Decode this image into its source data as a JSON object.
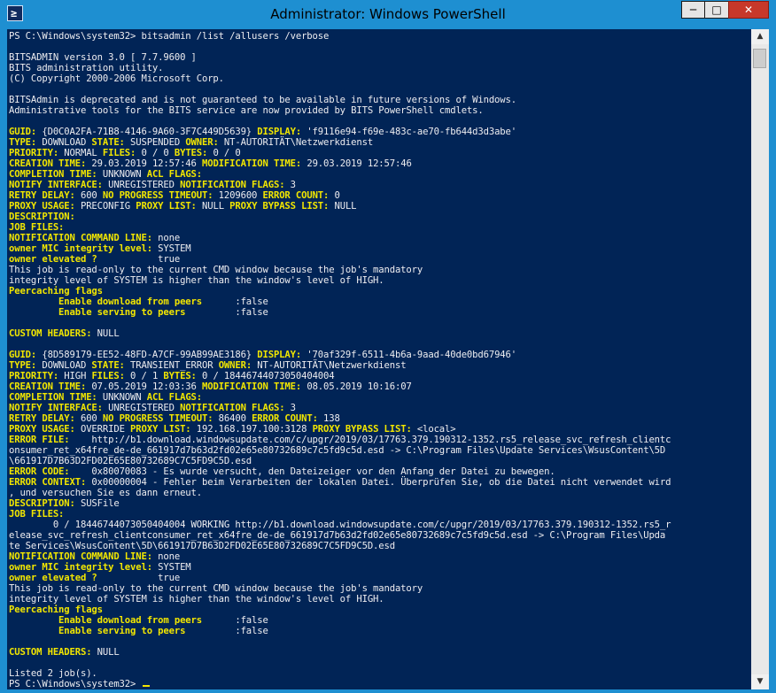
{
  "window": {
    "title": "Administrator: Windows PowerShell",
    "icon_glyph": "≥",
    "controls": {
      "minimize": "─",
      "maximize": "□",
      "close": "✕"
    },
    "colors": {
      "frame": "#1e8fd1",
      "console_bg": "#012456",
      "console_text": "#eeedf0",
      "highlight": "#f2e600"
    }
  },
  "scrollbar": {
    "up": "▲",
    "down": "▼"
  },
  "terminal": {
    "lines": [
      [
        [
          "w",
          "PS C:\\Windows\\system32> bitsadmin /list /allusers /verbose"
        ]
      ],
      [],
      [
        [
          "w",
          "BITSADMIN version 3.0 [ 7.7.9600 ]"
        ]
      ],
      [
        [
          "w",
          "BITS administration utility."
        ]
      ],
      [
        [
          "w",
          "(C) Copyright 2000-2006 Microsoft Corp."
        ]
      ],
      [],
      [
        [
          "w",
          "BITSAdmin is deprecated and is not guaranteed to be available in future versions of Windows."
        ]
      ],
      [
        [
          "w",
          "Administrative tools for the BITS service are now provided by BITS PowerShell cmdlets."
        ]
      ],
      [],
      [
        [
          "y",
          "GUID:"
        ],
        [
          "w",
          " {D0C0A2FA-71B8-4146-9A60-3F7C449D5639} "
        ],
        [
          "y",
          "DISPLAY:"
        ],
        [
          "w",
          " 'f9116e94-f69e-483c-ae70-fb644d3d3abe'"
        ]
      ],
      [
        [
          "y",
          "TYPE:"
        ],
        [
          "w",
          " DOWNLOAD "
        ],
        [
          "y",
          "STATE:"
        ],
        [
          "w",
          " SUSPENDED "
        ],
        [
          "y",
          "OWNER:"
        ],
        [
          "w",
          " NT-AUTORITÄT\\Netzwerkdienst"
        ]
      ],
      [
        [
          "y",
          "PRIORITY:"
        ],
        [
          "w",
          " NORMAL "
        ],
        [
          "y",
          "FILES:"
        ],
        [
          "w",
          " 0 / 0 "
        ],
        [
          "y",
          "BYTES:"
        ],
        [
          "w",
          " 0 / 0"
        ]
      ],
      [
        [
          "y",
          "CREATION TIME:"
        ],
        [
          "w",
          " 29.03.2019 12:57:46 "
        ],
        [
          "y",
          "MODIFICATION TIME:"
        ],
        [
          "w",
          " 29.03.2019 12:57:46"
        ]
      ],
      [
        [
          "y",
          "COMPLETION TIME:"
        ],
        [
          "w",
          " UNKNOWN "
        ],
        [
          "y",
          "ACL FLAGS:"
        ]
      ],
      [
        [
          "y",
          "NOTIFY INTERFACE:"
        ],
        [
          "w",
          " UNREGISTERED "
        ],
        [
          "y",
          "NOTIFICATION FLAGS:"
        ],
        [
          "w",
          " 3"
        ]
      ],
      [
        [
          "y",
          "RETRY DELAY:"
        ],
        [
          "w",
          " 600 "
        ],
        [
          "y",
          "NO PROGRESS TIMEOUT:"
        ],
        [
          "w",
          " 1209600 "
        ],
        [
          "y",
          "ERROR COUNT:"
        ],
        [
          "w",
          " 0"
        ]
      ],
      [
        [
          "y",
          "PROXY USAGE:"
        ],
        [
          "w",
          " PRECONFIG "
        ],
        [
          "y",
          "PROXY LIST:"
        ],
        [
          "w",
          " NULL "
        ],
        [
          "y",
          "PROXY BYPASS LIST:"
        ],
        [
          "w",
          " NULL"
        ]
      ],
      [
        [
          "y",
          "DESCRIPTION:"
        ]
      ],
      [
        [
          "y",
          "JOB FILES:"
        ]
      ],
      [
        [
          "y",
          "NOTIFICATION COMMAND LINE:"
        ],
        [
          "w",
          " none"
        ]
      ],
      [
        [
          "y",
          "owner MIC integrity level:"
        ],
        [
          "w",
          " SYSTEM"
        ]
      ],
      [
        [
          "y",
          "owner elevated ?"
        ],
        [
          "w",
          "           true"
        ]
      ],
      [
        [
          "w",
          "This job is read-only to the current CMD window because the job's mandatory"
        ]
      ],
      [
        [
          "w",
          "integrity level of SYSTEM is higher than the window's level of HIGH."
        ]
      ],
      [
        [
          "y",
          "Peercaching flags"
        ]
      ],
      [
        [
          "y",
          "         Enable download from peers"
        ],
        [
          "w",
          "      :false"
        ]
      ],
      [
        [
          "y",
          "         Enable serving to peers"
        ],
        [
          "w",
          "         :false"
        ]
      ],
      [],
      [
        [
          "y",
          "CUSTOM HEADERS:"
        ],
        [
          "w",
          " NULL"
        ]
      ],
      [],
      [
        [
          "y",
          "GUID:"
        ],
        [
          "w",
          " {8D589179-EE52-48FD-A7CF-99AB99AE3186} "
        ],
        [
          "y",
          "DISPLAY:"
        ],
        [
          "w",
          " '70af329f-6511-4b6a-9aad-40de0bd67946'"
        ]
      ],
      [
        [
          "y",
          "TYPE:"
        ],
        [
          "w",
          " DOWNLOAD "
        ],
        [
          "y",
          "STATE:"
        ],
        [
          "w",
          " TRANSIENT_ERROR "
        ],
        [
          "y",
          "OWNER:"
        ],
        [
          "w",
          " NT-AUTORITÄT\\Netzwerkdienst"
        ]
      ],
      [
        [
          "y",
          "PRIORITY:"
        ],
        [
          "w",
          " HIGH "
        ],
        [
          "y",
          "FILES:"
        ],
        [
          "w",
          " 0 / 1 "
        ],
        [
          "y",
          "BYTES:"
        ],
        [
          "w",
          " 0 / 18446744073050404004"
        ]
      ],
      [
        [
          "y",
          "CREATION TIME:"
        ],
        [
          "w",
          " 07.05.2019 12:03:36 "
        ],
        [
          "y",
          "MODIFICATION TIME:"
        ],
        [
          "w",
          " 08.05.2019 10:16:07"
        ]
      ],
      [
        [
          "y",
          "COMPLETION TIME:"
        ],
        [
          "w",
          " UNKNOWN "
        ],
        [
          "y",
          "ACL FLAGS:"
        ]
      ],
      [
        [
          "y",
          "NOTIFY INTERFACE:"
        ],
        [
          "w",
          " UNREGISTERED "
        ],
        [
          "y",
          "NOTIFICATION FLAGS:"
        ],
        [
          "w",
          " 3"
        ]
      ],
      [
        [
          "y",
          "RETRY DELAY:"
        ],
        [
          "w",
          " 600 "
        ],
        [
          "y",
          "NO PROGRESS TIMEOUT:"
        ],
        [
          "w",
          " 86400 "
        ],
        [
          "y",
          "ERROR COUNT:"
        ],
        [
          "w",
          " 138"
        ]
      ],
      [
        [
          "y",
          "PROXY USAGE:"
        ],
        [
          "w",
          " OVERRIDE "
        ],
        [
          "y",
          "PROXY LIST:"
        ],
        [
          "w",
          " 192.168.197.100:3128 "
        ],
        [
          "y",
          "PROXY BYPASS LIST:"
        ],
        [
          "w",
          " <local>"
        ]
      ],
      [
        [
          "y",
          "ERROR FILE:"
        ],
        [
          "w",
          "    http://b1.download.windowsupdate.com/c/upgr/2019/03/17763.379.190312-1352.rs5_release_svc_refresh_clientc"
        ]
      ],
      [
        [
          "w",
          "onsumer_ret_x64fre_de-de_661917d7b63d2fd02e65e80732689c7c5fd9c5d.esd -> C:\\Program Files\\Update Services\\WsusContent\\5D"
        ]
      ],
      [
        [
          "w",
          "\\661917D7B63D2FD02E65E80732689C7C5FD9C5D.esd"
        ]
      ],
      [
        [
          "y",
          "ERROR CODE:"
        ],
        [
          "w",
          "    0x80070083 - Es wurde versucht, den Dateizeiger vor den Anfang der Datei zu bewegen."
        ]
      ],
      [
        [
          "y",
          "ERROR CONTEXT:"
        ],
        [
          "w",
          " 0x00000004 - Fehler beim Verarbeiten der lokalen Datei. Überprüfen Sie, ob die Datei nicht verwendet wird"
        ]
      ],
      [
        [
          "w",
          ", und versuchen Sie es dann erneut."
        ]
      ],
      [
        [
          "y",
          "DESCRIPTION:"
        ],
        [
          "w",
          " SUSFile"
        ]
      ],
      [
        [
          "y",
          "JOB FILES:"
        ]
      ],
      [
        [
          "w",
          "        0 / 18446744073050404004 WORKING http://b1.download.windowsupdate.com/c/upgr/2019/03/17763.379.190312-1352.rs5_r"
        ]
      ],
      [
        [
          "w",
          "elease_svc_refresh_clientconsumer_ret_x64fre_de-de_661917d7b63d2fd02e65e80732689c7c5fd9c5d.esd -> C:\\Program Files\\Upda"
        ]
      ],
      [
        [
          "w",
          "te Services\\WsusContent\\5D\\661917D7B63D2FD02E65E80732689C7C5FD9C5D.esd"
        ]
      ],
      [
        [
          "y",
          "NOTIFICATION COMMAND LINE:"
        ],
        [
          "w",
          " none"
        ]
      ],
      [
        [
          "y",
          "owner MIC integrity level:"
        ],
        [
          "w",
          " SYSTEM"
        ]
      ],
      [
        [
          "y",
          "owner elevated ?"
        ],
        [
          "w",
          "           true"
        ]
      ],
      [
        [
          "w",
          "This job is read-only to the current CMD window because the job's mandatory"
        ]
      ],
      [
        [
          "w",
          "integrity level of SYSTEM is higher than the window's level of HIGH."
        ]
      ],
      [
        [
          "y",
          "Peercaching flags"
        ]
      ],
      [
        [
          "y",
          "         Enable download from peers"
        ],
        [
          "w",
          "      :false"
        ]
      ],
      [
        [
          "y",
          "         Enable serving to peers"
        ],
        [
          "w",
          "         :false"
        ]
      ],
      [],
      [
        [
          "y",
          "CUSTOM HEADERS:"
        ],
        [
          "w",
          " NULL"
        ]
      ],
      [],
      [
        [
          "w",
          "Listed 2 job(s)."
        ]
      ],
      [
        [
          "w",
          "PS C:\\Windows\\system32> "
        ]
      ]
    ]
  }
}
